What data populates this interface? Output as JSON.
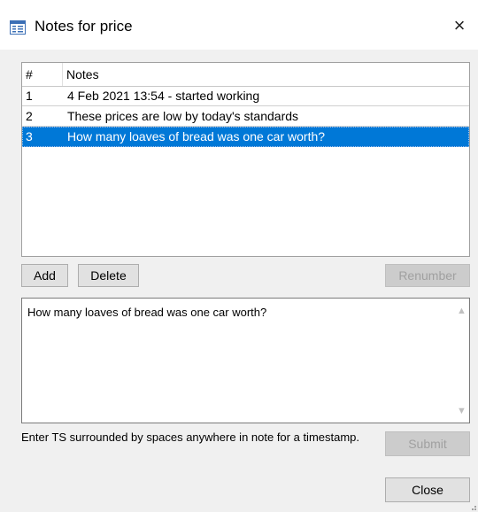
{
  "window": {
    "title": "Notes for price",
    "icon": "form-window-icon",
    "close_icon": "×"
  },
  "list": {
    "columns": [
      "#",
      "Notes"
    ],
    "rows": [
      {
        "num": "1",
        "note": "4 Feb 2021 13:54 - started working",
        "selected": false
      },
      {
        "num": "2",
        "note": "These prices are low by today's standards",
        "selected": false
      },
      {
        "num": "3",
        "note": "How many loaves of bread was one car worth?",
        "selected": true
      }
    ]
  },
  "buttons": {
    "add": "Add",
    "delete": "Delete",
    "renumber": "Renumber",
    "submit": "Submit",
    "close": "Close"
  },
  "editor": {
    "value": "How many loaves of bread was one car worth?",
    "scroll_up_icon": "▲",
    "scroll_down_icon": "▼"
  },
  "hint": "Enter TS surrounded by spaces anywhere in note for a timestamp.",
  "colors": {
    "selection": "#0078d7",
    "dialog_bg": "#f0f0f0"
  }
}
